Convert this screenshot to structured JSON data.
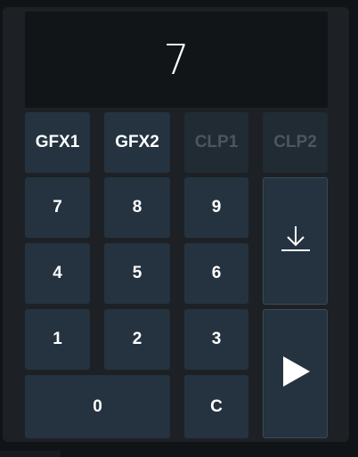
{
  "display": {
    "value": "7"
  },
  "buttons": {
    "gfx1": "GFX1",
    "gfx2": "GFX2",
    "clp1": "CLP1",
    "clp2": "CLP2",
    "n7": "7",
    "n8": "8",
    "n9": "9",
    "n4": "4",
    "n5": "5",
    "n6": "6",
    "n1": "1",
    "n2": "2",
    "n3": "3",
    "n0": "0",
    "clear": "C"
  },
  "icons": {
    "load": "download-icon",
    "play": "play-icon"
  },
  "colors": {
    "button_bg": "#24333f",
    "disabled_text": "#4b5661",
    "display_bg": "#121517"
  }
}
